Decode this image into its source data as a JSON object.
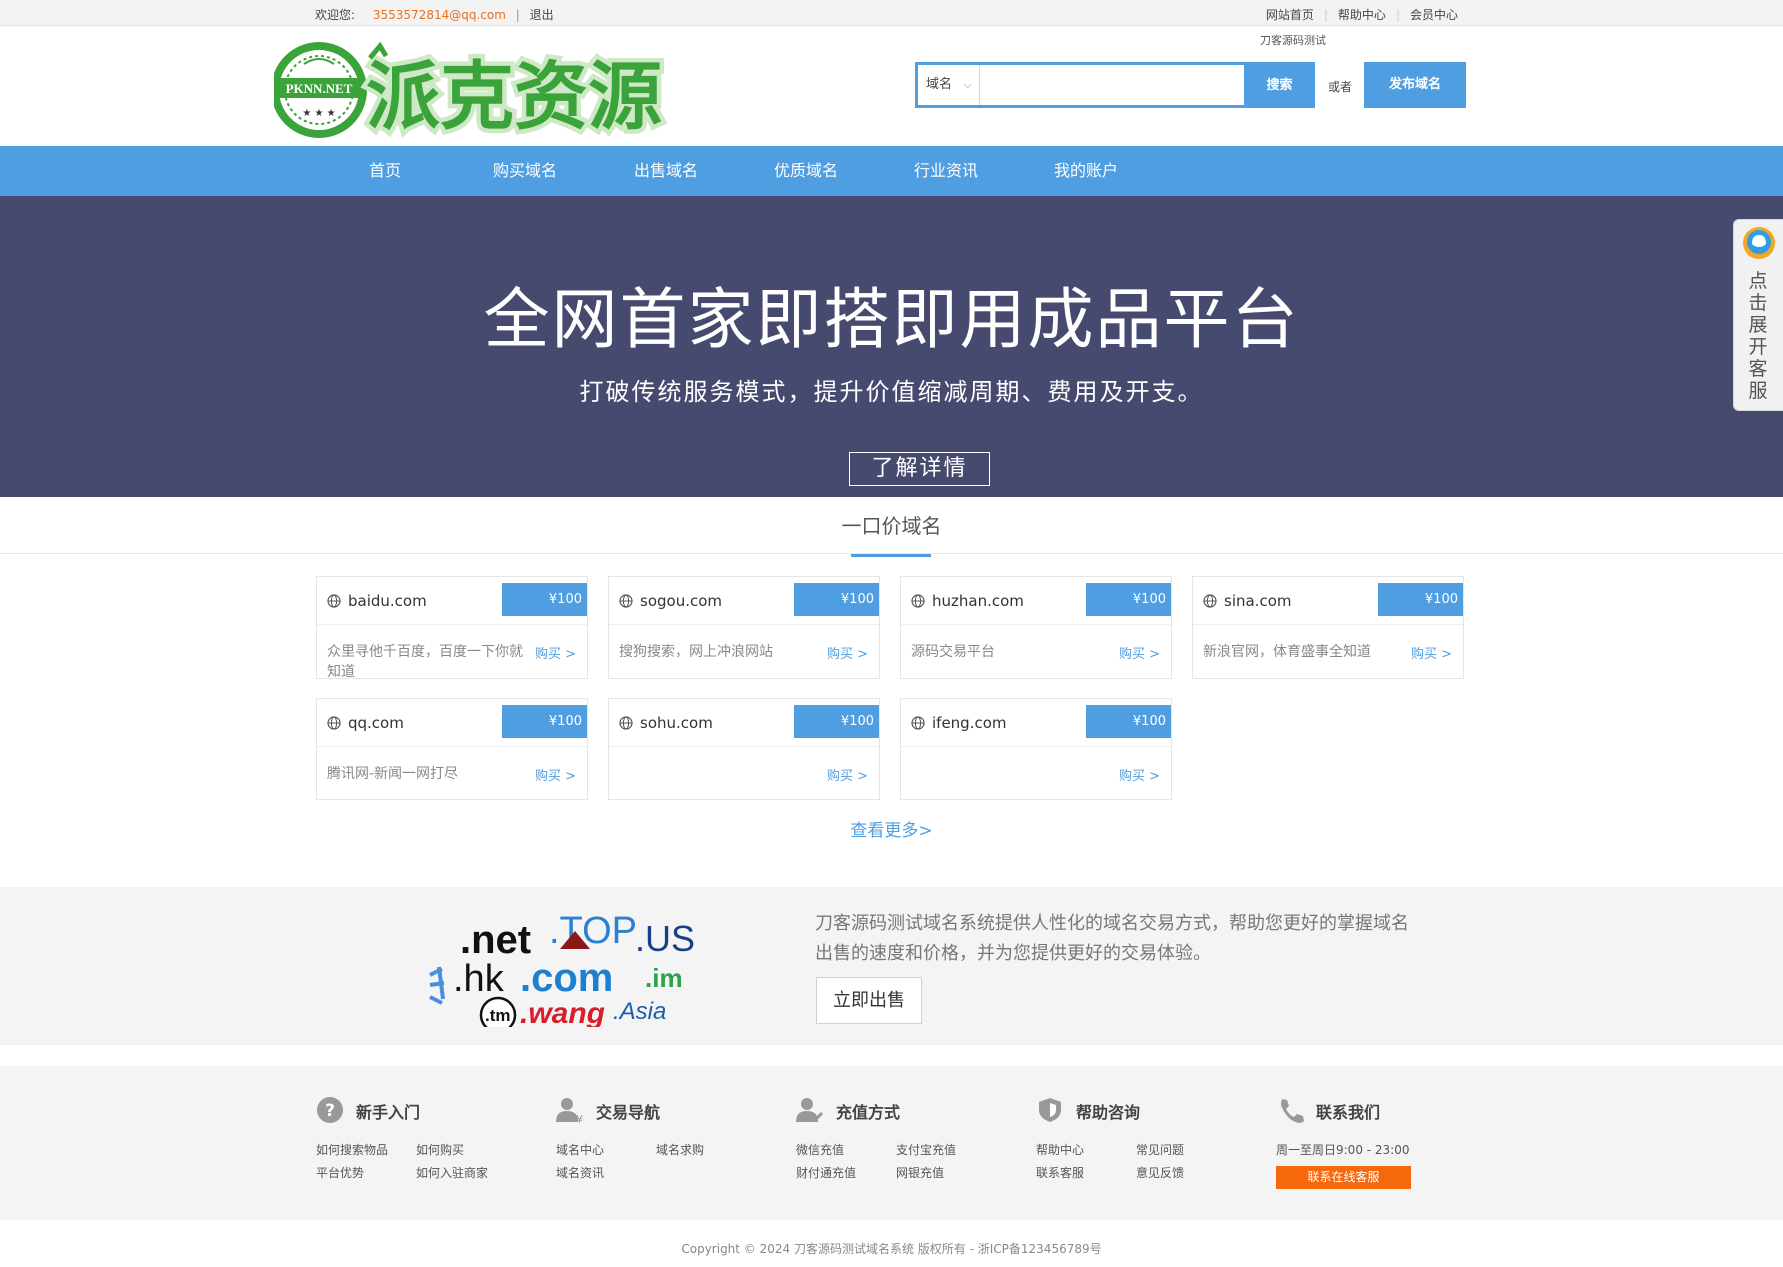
{
  "topbar": {
    "welcome": "欢迎您:",
    "email": "3553572814@qq.com",
    "separator": "|",
    "logout": "退出",
    "links": [
      "网站首页",
      "帮助中心",
      "会员中心"
    ]
  },
  "header": {
    "logo_text": "派克资源",
    "logo_badge": "PKNN.NET",
    "search_hint": "刀客源码测试",
    "search_type": "域名",
    "search_placeholder": "",
    "search_button": "搜索",
    "or_text": "或者",
    "publish_button": "发布域名"
  },
  "nav": {
    "items": [
      "首页",
      "购买域名",
      "出售域名",
      "优质域名",
      "行业资讯",
      "我的账户"
    ]
  },
  "banner": {
    "title": "全网首家即搭即用成品平台",
    "subtitle": "打破传统服务模式，提升价值缩减周期、费用及开支。",
    "button": "了解详情"
  },
  "side_service": {
    "text": "点击展开客服"
  },
  "section": {
    "title": "一口价域名",
    "more": "查看更多>"
  },
  "domains": [
    {
      "name": "baidu.com",
      "price": "¥100",
      "desc": "众里寻他千百度，百度一下你就知道",
      "buy": "购买 >"
    },
    {
      "name": "sogou.com",
      "price": "¥100",
      "desc": "搜狗搜索，网上冲浪网站",
      "buy": "购买 >"
    },
    {
      "name": "huzhan.com",
      "price": "¥100",
      "desc": "源码交易平台",
      "buy": "购买 >"
    },
    {
      "name": "sina.com",
      "price": "¥100",
      "desc": "新浪官网，体育盛事全知道",
      "buy": "购买 >"
    },
    {
      "name": "qq.com",
      "price": "¥100",
      "desc": "腾讯网-新闻一网打尽",
      "buy": "购买 >"
    },
    {
      "name": "sohu.com",
      "price": "¥100",
      "desc": "",
      "buy": "购买 >"
    },
    {
      "name": "ifeng.com",
      "price": "¥100",
      "desc": "",
      "buy": "购买 >"
    }
  ],
  "promo": {
    "art_words": [
      ".net",
      ".TOP",
      ".US",
      ".hk",
      ".com",
      ".im",
      ".tm",
      ".wang",
      ".Asia"
    ],
    "text": "刀客源码测试域名系统提供人性化的域名交易方式，帮助您更好的掌握域名出售的速度和价格，并为您提供更好的交易体验。",
    "button": "立即出售"
  },
  "help": {
    "columns": [
      {
        "title": "新手入门",
        "icon": "question-icon",
        "links": [
          "如何搜索物品",
          "如何购买",
          "平台优势",
          "如何入驻商家"
        ]
      },
      {
        "title": "交易导航",
        "icon": "user-money-icon",
        "links": [
          "域名中心",
          "域名求购",
          "域名资讯"
        ]
      },
      {
        "title": "充值方式",
        "icon": "user-edit-icon",
        "links": [
          "微信充值",
          "支付宝充值",
          "财付通充值",
          "网银充值"
        ]
      },
      {
        "title": "帮助咨询",
        "icon": "shield-icon",
        "links": [
          "帮助中心",
          "常见问题",
          "联系客服",
          "意见反馈"
        ]
      },
      {
        "title": "联系我们",
        "icon": "phone-icon",
        "hours": "周一至周日9:00 - 23:00",
        "button": "联系在线客服"
      }
    ]
  },
  "copyright": "Copyright © 2024 刀客源码测试域名系统 版权所有 - 浙ICP备123456789号",
  "colors": {
    "primary": "#4f9ee1",
    "banner_bg": "#474a6f",
    "accent_orange": "#f7670c",
    "email_orange": "#e8711b",
    "logo_green": "#3aa33a"
  }
}
